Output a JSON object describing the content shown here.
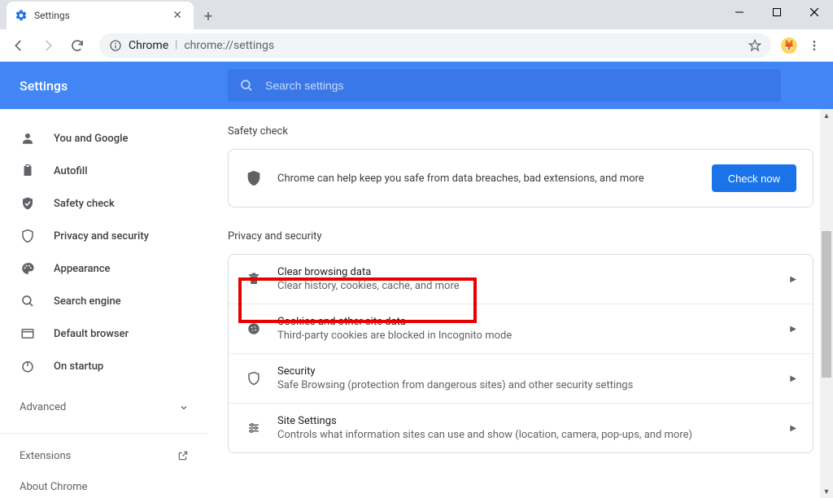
{
  "window": {
    "tab_title": "Settings",
    "omnibox_origin": "Chrome",
    "omnibox_path": "chrome://settings"
  },
  "header": {
    "title": "Settings",
    "search_placeholder": "Search settings"
  },
  "sidebar": {
    "items": [
      {
        "label": "You and Google"
      },
      {
        "label": "Autofill"
      },
      {
        "label": "Safety check"
      },
      {
        "label": "Privacy and security"
      },
      {
        "label": "Appearance"
      },
      {
        "label": "Search engine"
      },
      {
        "label": "Default browser"
      },
      {
        "label": "On startup"
      }
    ],
    "advanced": "Advanced",
    "extensions": "Extensions",
    "about": "About Chrome"
  },
  "content": {
    "safety_check_title": "Safety check",
    "safety_check_text": "Chrome can help keep you safe from data breaches, bad extensions, and more",
    "check_now": "Check now",
    "privacy_title": "Privacy and security",
    "rows": [
      {
        "title": "Clear browsing data",
        "sub": "Clear history, cookies, cache, and more"
      },
      {
        "title": "Cookies and other site data",
        "sub": "Third-party cookies are blocked in Incognito mode"
      },
      {
        "title": "Security",
        "sub": "Safe Browsing (protection from dangerous sites) and other security settings"
      },
      {
        "title": "Site Settings",
        "sub": "Controls what information sites can use and show (location, camera, pop-ups, and more)"
      }
    ]
  }
}
